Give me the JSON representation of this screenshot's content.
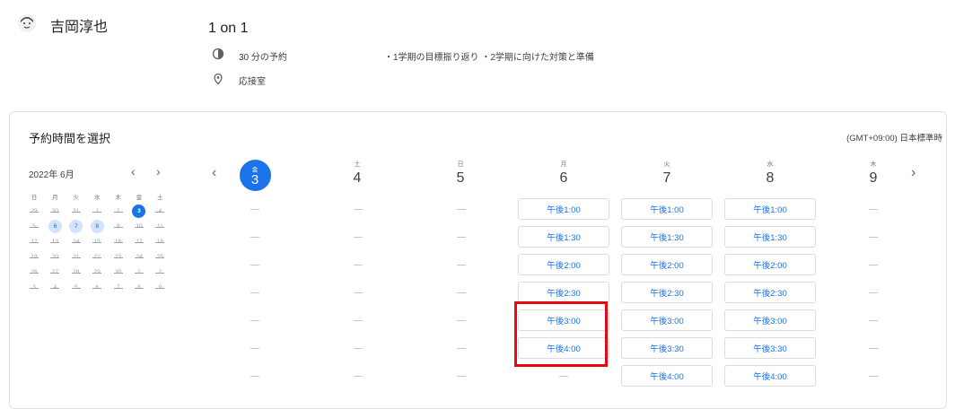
{
  "owner": {
    "name": "吉岡淳也"
  },
  "event": {
    "title": "1 on 1",
    "duration": "30 分の予約",
    "description": "・1学期の目標振り返り ・2学期に向けた対策と準備",
    "location": "応接室"
  },
  "booking": {
    "heading": "予約時間を選択",
    "timezone": "(GMT+09:00) 日本標準時"
  },
  "mini_calendar": {
    "month_label": "2022年 6月",
    "prev": "‹",
    "next": "›",
    "weekdays": [
      "日",
      "月",
      "火",
      "水",
      "木",
      "金",
      "土"
    ],
    "weeks": [
      [
        "29",
        "30",
        "31",
        "1",
        "2",
        "3",
        "4"
      ],
      [
        "5",
        "6",
        "7",
        "8",
        "9",
        "10",
        "11"
      ],
      [
        "12",
        "13",
        "14",
        "15",
        "16",
        "17",
        "18"
      ],
      [
        "19",
        "20",
        "21",
        "22",
        "23",
        "24",
        "25"
      ],
      [
        "26",
        "27",
        "28",
        "29",
        "30",
        "1",
        "2"
      ],
      [
        "3",
        "4",
        "5",
        "6",
        "7",
        "8",
        "9"
      ]
    ],
    "selected": "3",
    "available": [
      "6",
      "7",
      "8"
    ]
  },
  "week": {
    "prev": "‹",
    "next": "›",
    "days": [
      {
        "dow": "金",
        "num": "3"
      },
      {
        "dow": "土",
        "num": "4"
      },
      {
        "dow": "日",
        "num": "5"
      },
      {
        "dow": "月",
        "num": "6"
      },
      {
        "dow": "火",
        "num": "7"
      },
      {
        "dow": "水",
        "num": "8"
      },
      {
        "dow": "木",
        "num": "9"
      }
    ],
    "slots": {
      "mon": [
        "午後1:00",
        "午後1:30",
        "午後2:00",
        "午後2:30",
        "午後3:00",
        "午後4:00"
      ],
      "tue": [
        "午後1:00",
        "午後1:30",
        "午後2:00",
        "午後2:30",
        "午後3:00",
        "午後3:30",
        "午後4:00"
      ],
      "wed": [
        "午後1:00",
        "午後1:30",
        "午後2:00",
        "午後2:30",
        "午後3:00",
        "午後3:30",
        "午後4:00"
      ]
    }
  },
  "colors": {
    "accent": "#1a73e8",
    "highlight": "#e50914"
  }
}
